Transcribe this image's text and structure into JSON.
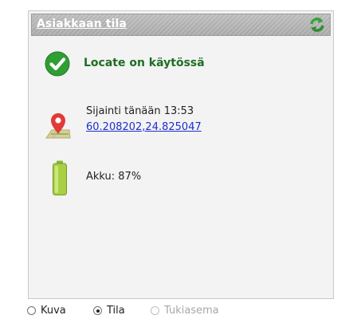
{
  "panel": {
    "title": "Asiakkaan tila",
    "refresh_icon": "refresh-icon"
  },
  "status": {
    "icon": "check-circle-icon",
    "text": "Locate on käytössä",
    "color": "#1f6d24"
  },
  "location": {
    "icon": "map-pin-icon",
    "label": "Sijainti tänään 13:53",
    "coordinates": "60.208202,24.825047"
  },
  "battery": {
    "icon": "battery-icon",
    "text": "Akku: 87%",
    "level": 0.87
  },
  "view_options": [
    {
      "label": "Kuva",
      "selected": false,
      "enabled": true
    },
    {
      "label": "Tila",
      "selected": true,
      "enabled": true
    },
    {
      "label": "Tukiasema",
      "selected": false,
      "enabled": false
    }
  ]
}
